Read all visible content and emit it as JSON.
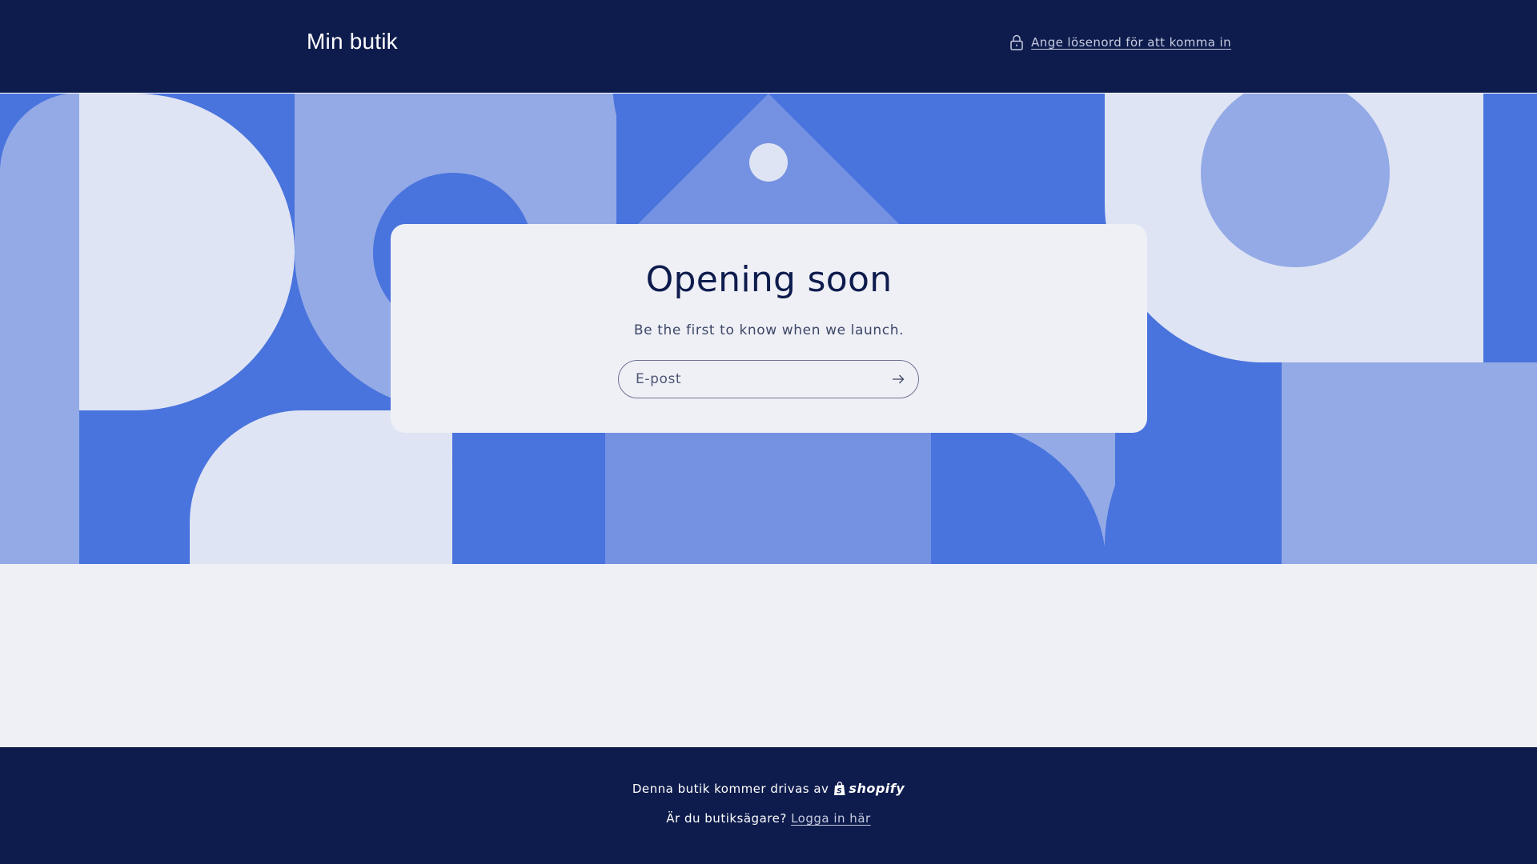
{
  "header": {
    "store_name": "Min butik",
    "password_link": "Ange lösenord för att komma in",
    "password_icon": "lock-icon"
  },
  "hero": {
    "title": "Opening soon",
    "subtitle": "Be the first to know when we launch.",
    "email_placeholder": "E-post",
    "email_value": "",
    "submit_icon": "arrow-right-icon"
  },
  "footer": {
    "powered_text": "Denna butik kommer drivas av",
    "powered_brand": "shopify",
    "owner_question": "Är du butiksägare?",
    "login_link": "Logga in här"
  },
  "colors": {
    "navy": "#0e1c4d",
    "background": "#eff0f6",
    "blue": "#4973dd",
    "blue_mid": "#7592e2",
    "blue_light": "#93aae6",
    "blue_pale": "#dfe4f4"
  }
}
